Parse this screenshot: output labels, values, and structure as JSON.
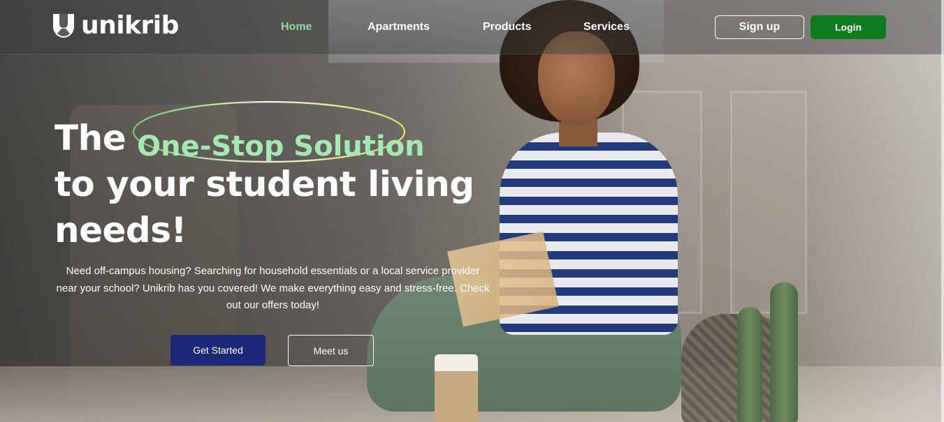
{
  "brand": {
    "name": "unikrib",
    "logo_icon": "unikrib-shield-icon"
  },
  "nav": {
    "items": [
      {
        "label": "Home",
        "active": true
      },
      {
        "label": "Apartments",
        "active": false
      },
      {
        "label": "Products",
        "active": false
      },
      {
        "label": "Services",
        "active": false
      }
    ]
  },
  "auth": {
    "signup_label": "Sign up",
    "login_label": "Login"
  },
  "hero": {
    "headline_prefix": "The",
    "headline_highlight": "One-Stop Solution",
    "headline_line2": "to your student living",
    "headline_line3": "needs!",
    "description": "Need off-campus housing? Searching for household essentials or a local service provider near your school? Unikrib has you covered! We make everything easy and stress-free. Check out our offers today!",
    "primary_cta": "Get Started",
    "secondary_cta": "Meet us"
  },
  "colors": {
    "accent_green": "#0f7a1f",
    "highlight_green": "#a6e8b2",
    "active_nav": "#8fd9a3",
    "primary_button": "#1b2a78"
  }
}
